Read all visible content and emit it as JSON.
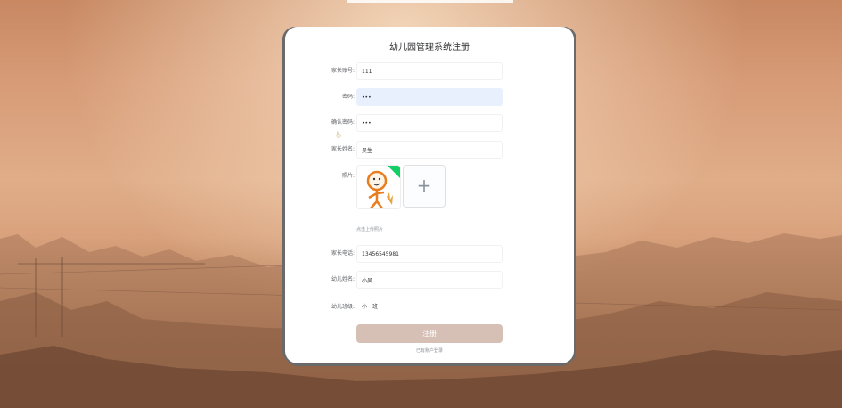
{
  "colors": {
    "accent": "#d6bfb5",
    "focus": "#e8f0fe",
    "badge": "#13ce66"
  },
  "form": {
    "title": "幼儿园管理系统注册",
    "account": {
      "label": "家长账号:",
      "value": "111"
    },
    "password": {
      "label": "密码:",
      "value": "•••"
    },
    "confirm": {
      "label": "确认密码:",
      "value": "•••"
    },
    "parent_name": {
      "label": "家长姓名:",
      "value": "吴生"
    },
    "photo": {
      "label": "照片:",
      "tip": "点击上传照片",
      "add_icon": "plus-icon"
    },
    "phone": {
      "label": "家长电话:",
      "value": "13456545981"
    },
    "child_name": {
      "label": "幼儿姓名:",
      "value": "小吴"
    },
    "child_class": {
      "label": "幼儿班级:",
      "value": "小一班"
    },
    "submit_label": "注册",
    "login_link": "已有账户登录"
  }
}
